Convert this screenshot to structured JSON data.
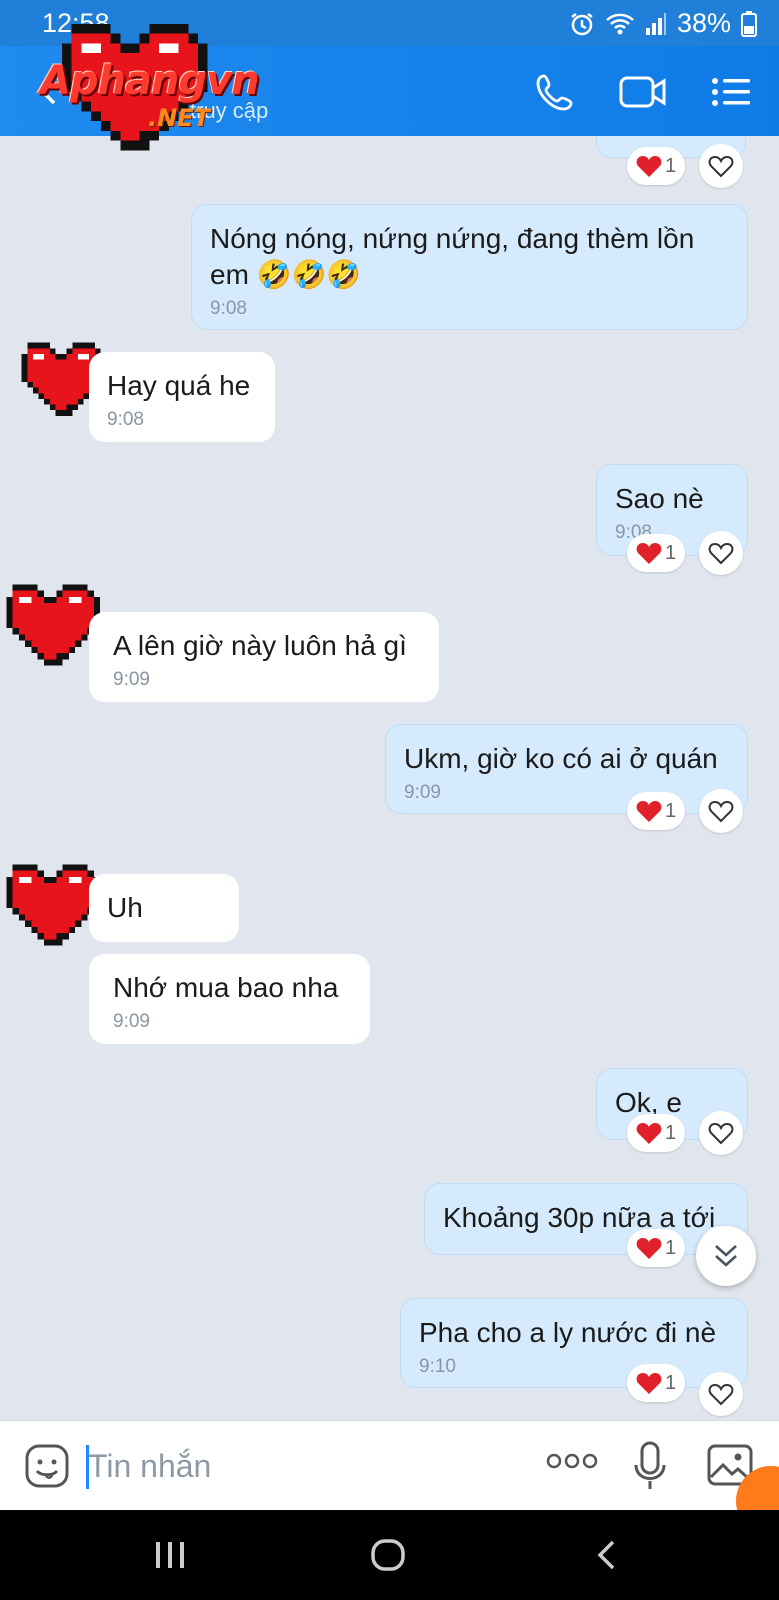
{
  "status_bar": {
    "time": "12:58",
    "battery": "38%"
  },
  "header": {
    "subtitle": "truy cập",
    "back_icon": "back-arrow-icon"
  },
  "watermark": {
    "text": "Aphangvn",
    "suffix": ".NET"
  },
  "messages": [
    {
      "side": "out",
      "text": "Nóng nóng, nứng nứng, đang thèm lồn em 🤣🤣🤣",
      "time": "9:08"
    },
    {
      "side": "in",
      "text": "Hay quá he",
      "time": "9:08"
    },
    {
      "side": "out",
      "text": "Sao nè",
      "time": "9:08",
      "reaction": "1"
    },
    {
      "side": "in",
      "text": "A lên giờ này luôn hả gì",
      "time": "9:09"
    },
    {
      "side": "out",
      "text": "Ukm, giờ ko có ai ở quán",
      "time": "9:09",
      "reaction": "1"
    },
    {
      "side": "in",
      "text": "Uh"
    },
    {
      "side": "in",
      "text": "Nhớ mua bao nha",
      "time": "9:09"
    },
    {
      "side": "out",
      "text": "Ok, e",
      "reaction": "1"
    },
    {
      "side": "out",
      "text": "Khoảng 30p nữa a tới",
      "reaction": "1"
    },
    {
      "side": "out",
      "text": "Pha cho a ly nước đi nè",
      "time": "9:10",
      "reaction": "1"
    }
  ],
  "top_reaction": "1",
  "composer": {
    "placeholder": "Tin nhắn"
  },
  "colors": {
    "header": "#1f7fd9",
    "outgoing_bubble": "#d5eafc",
    "incoming_bubble": "#ffffff",
    "background": "#e1e6ee"
  }
}
